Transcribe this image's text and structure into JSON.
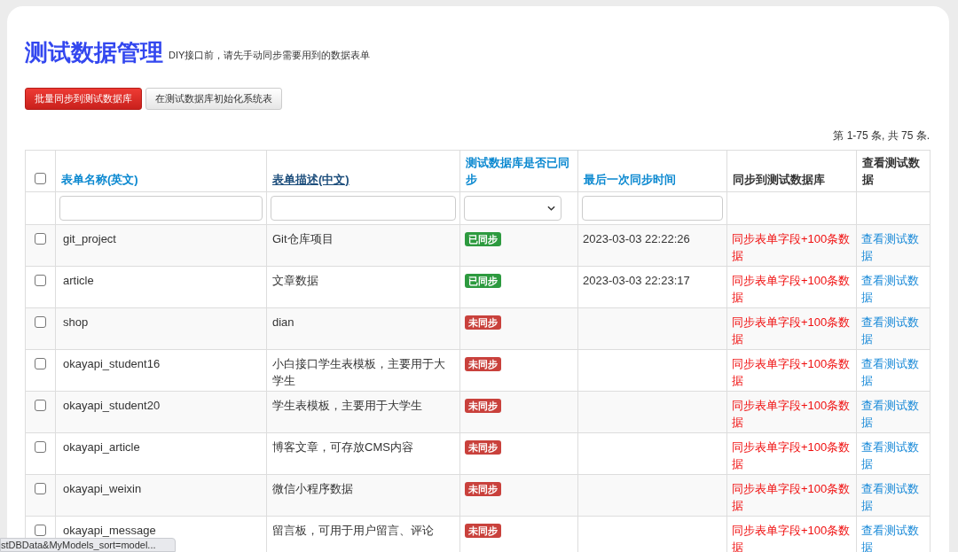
{
  "header": {
    "title": "测试数据管理",
    "subtitle": "DIY接口前，请先手动同步需要用到的数据表单"
  },
  "buttons": [
    {
      "label": "批量同步到测试数据库",
      "kind": "primary"
    },
    {
      "label": "在测试数据库初始化系统表",
      "kind": "default"
    }
  ],
  "summary": "第 1-75 条, 共 75 条.",
  "table": {
    "select_all": {
      "checked": false
    },
    "columns": [
      {
        "label": "表单名称(英文)",
        "kind": "link",
        "sorted": false
      },
      {
        "label": "表单描述(中文)",
        "kind": "link",
        "sorted": true
      },
      {
        "label": "测试数据库是否已同步",
        "kind": "link",
        "sorted": false
      },
      {
        "label": "最后一次同步时间",
        "kind": "link",
        "sorted": false
      },
      {
        "label": "同步到测试数据库",
        "kind": "plain"
      },
      {
        "label": "查看测试数据",
        "kind": "plain"
      }
    ],
    "filters": [
      {
        "kind": "text"
      },
      {
        "kind": "text"
      },
      {
        "kind": "select"
      },
      {
        "kind": "text"
      },
      {
        "kind": "none"
      },
      {
        "kind": "none"
      }
    ],
    "rows": [
      {
        "checked": false,
        "name": "git_project",
        "description": "Git仓库项目",
        "status": "已同步",
        "synced": true,
        "time": "2023-03-03 22:22:26",
        "sync_action": "同步表单字段+100条数据",
        "view_action": "查看测试数据"
      },
      {
        "checked": false,
        "name": "article",
        "description": "文章数据",
        "status": "已同步",
        "synced": true,
        "time": "2023-03-03 22:23:17",
        "sync_action": "同步表单字段+100条数据",
        "view_action": "查看测试数据"
      },
      {
        "checked": false,
        "name": "shop",
        "description": "dian",
        "status": "未同步",
        "synced": false,
        "sync_action": "同步表单字段+100条数据",
        "view_action": "查看测试数据"
      },
      {
        "checked": false,
        "name": "okayapi_student16",
        "description": "小白接口学生表模板，主要用于大学生",
        "status": "未同步",
        "synced": false,
        "sync_action": "同步表单字段+100条数据",
        "view_action": "查看测试数据"
      },
      {
        "checked": false,
        "name": "okayapi_student20",
        "description": "学生表模板，主要用于大学生",
        "status": "未同步",
        "synced": false,
        "sync_action": "同步表单字段+100条数据",
        "view_action": "查看测试数据"
      },
      {
        "checked": false,
        "name": "okayapi_article",
        "description": "博客文章，可存放CMS内容",
        "status": "未同步",
        "synced": false,
        "sync_action": "同步表单字段+100条数据",
        "view_action": "查看测试数据"
      },
      {
        "checked": false,
        "name": "okayapi_weixin",
        "description": "微信小程序数据",
        "status": "未同步",
        "synced": false,
        "sync_action": "同步表单字段+100条数据",
        "view_action": "查看测试数据"
      },
      {
        "checked": false,
        "name": "okayapi_message",
        "description": "留言板，可用于用户留言、评论",
        "status": "未同步",
        "synced": false,
        "sync_action": "同步表单字段+100条数据",
        "view_action": "查看测试数据"
      }
    ]
  },
  "status_bar": {
    "url": "stDBData&MyModels_sort=model..."
  }
}
